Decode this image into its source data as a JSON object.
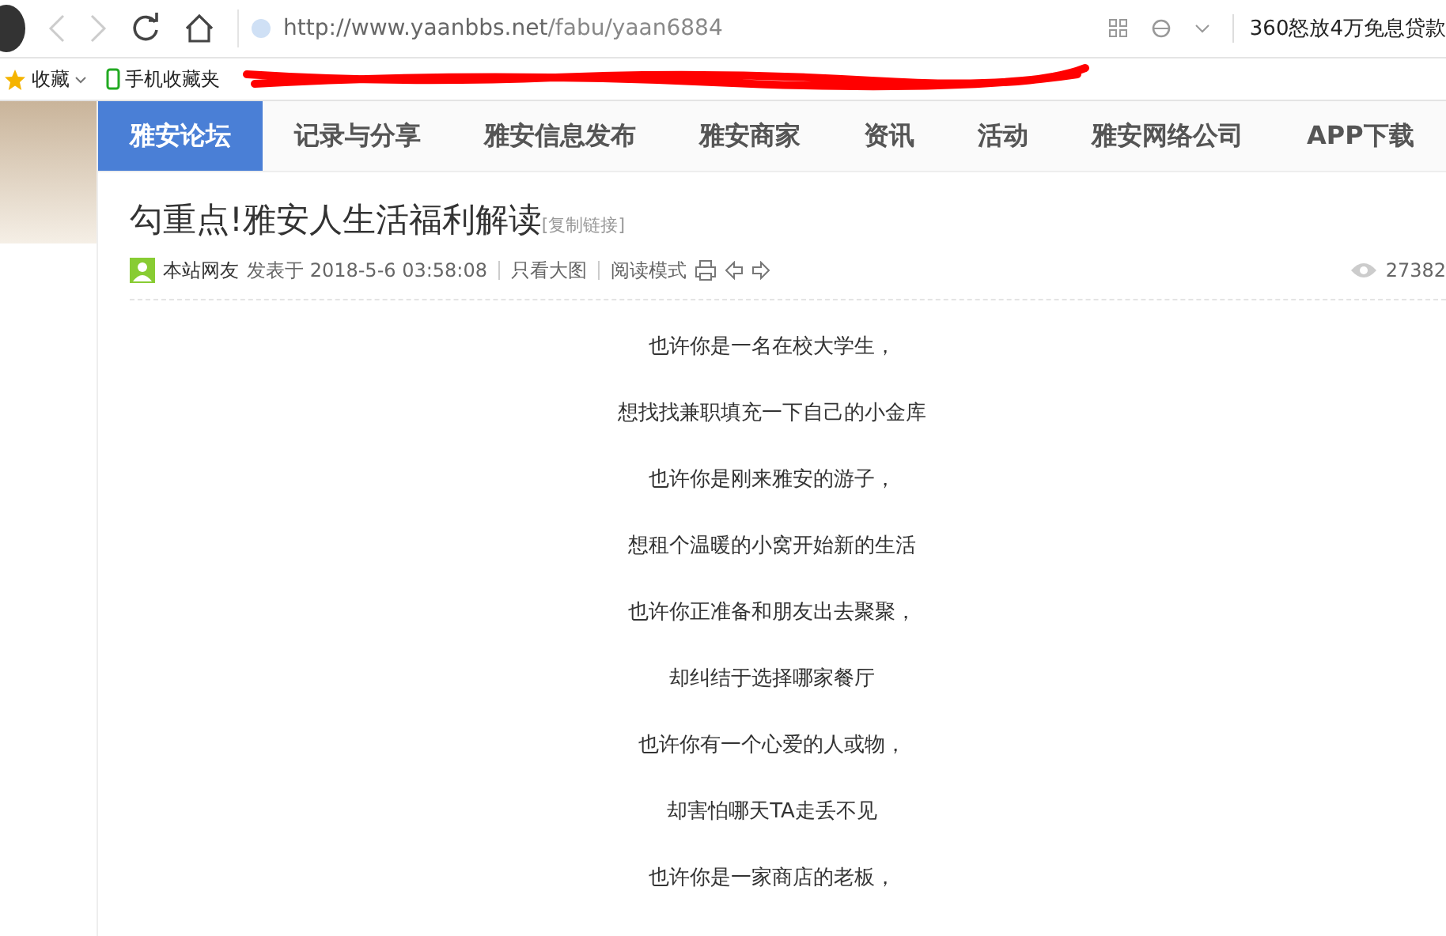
{
  "browser": {
    "url_host": "http://www.yaanbbs.net",
    "url_path": "/fabu/yaan6884",
    "news_ticker": "360怒放4万免息贷款"
  },
  "bookmarks": [
    {
      "label": "收藏",
      "kind": "star"
    },
    {
      "label": "手机收藏夹",
      "kind": "phone"
    }
  ],
  "nav": [
    {
      "label": "雅安论坛",
      "selected": true
    },
    {
      "label": "记录与分享",
      "selected": false
    },
    {
      "label": "雅安信息发布",
      "selected": false
    },
    {
      "label": "雅安商家",
      "selected": false
    },
    {
      "label": "资讯",
      "selected": false
    },
    {
      "label": "活动",
      "selected": false
    },
    {
      "label": "雅安网络公司",
      "selected": false
    },
    {
      "label": "APP下载",
      "selected": false
    }
  ],
  "post": {
    "title": "勾重点!雅安人生活福利解读",
    "copy_link": "[复制链接]",
    "author": "本站网友",
    "posted": "发表于 2018-5-6 03:58:08",
    "only_images": "只看大图",
    "reading_mode": "阅读模式",
    "views": "27382"
  },
  "paragraphs": [
    "也许你是一名在校大学生，",
    "想找找兼职填充一下自己的小金库",
    "也许你是刚来雅安的游子，",
    "想租个温暖的小窝开始新的生活",
    "也许你正准备和朋友出去聚聚，",
    "却纠结于选择哪家餐厅",
    "也许你有一个心爱的人或物，",
    "却害怕哪天TA走丢不见",
    "也许你是一家商店的老板，"
  ]
}
